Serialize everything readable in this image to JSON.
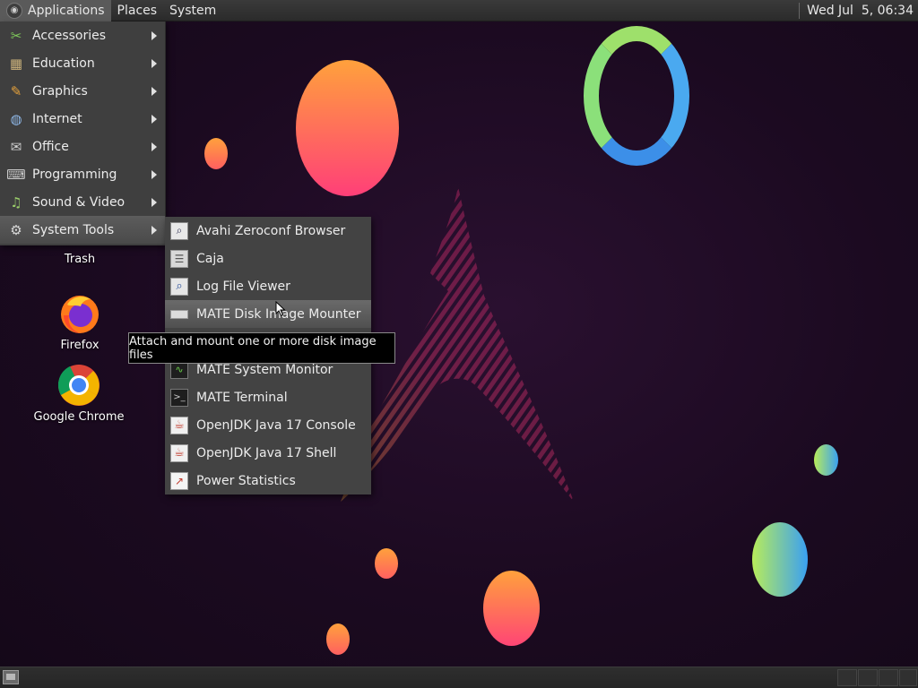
{
  "top_panel": {
    "menus": [
      "Applications",
      "Places",
      "System"
    ],
    "clock": "Wed Jul  5, 06:34"
  },
  "desktop_icons": [
    {
      "label": "Trash",
      "icon": "trash-icon"
    },
    {
      "label": "Firefox",
      "icon": "firefox-icon"
    },
    {
      "label": "Google Chrome",
      "icon": "chrome-icon"
    }
  ],
  "app_menu": {
    "categories": [
      {
        "label": "Accessories",
        "icon": "accessories-icon"
      },
      {
        "label": "Education",
        "icon": "education-icon"
      },
      {
        "label": "Graphics",
        "icon": "graphics-icon"
      },
      {
        "label": "Internet",
        "icon": "internet-icon"
      },
      {
        "label": "Office",
        "icon": "office-icon"
      },
      {
        "label": "Programming",
        "icon": "programming-icon"
      },
      {
        "label": "Sound & Video",
        "icon": "sound-video-icon"
      },
      {
        "label": "System Tools",
        "icon": "system-tools-icon"
      }
    ],
    "active_category": "System Tools"
  },
  "system_tools_submenu": {
    "items": [
      {
        "label": "Avahi Zeroconf Browser",
        "icon": "avahi-icon"
      },
      {
        "label": "Caja",
        "icon": "file-cabinet-icon"
      },
      {
        "label": "Log File Viewer",
        "icon": "log-viewer-icon"
      },
      {
        "label": "MATE Disk Image Mounter",
        "icon": "disk-icon"
      },
      {
        "label": "",
        "icon": ""
      },
      {
        "label": "MATE System Monitor",
        "icon": "system-monitor-icon"
      },
      {
        "label": "MATE Terminal",
        "icon": "terminal-icon"
      },
      {
        "label": "OpenJDK Java 17 Console",
        "icon": "java-icon"
      },
      {
        "label": "OpenJDK Java 17 Shell",
        "icon": "java-icon"
      },
      {
        "label": "Power Statistics",
        "icon": "power-stats-icon"
      }
    ],
    "hovered": "MATE Disk Image Mounter"
  },
  "tooltip": {
    "text": "Attach and mount one or more disk image files"
  },
  "colors": {
    "panel_bg": "#2b2b2b",
    "menu_bg": "#3f3f3f",
    "desktop_bg": "#1b0a20",
    "accent_pink": "#e8287a",
    "accent_orange": "#ff9a3c"
  }
}
